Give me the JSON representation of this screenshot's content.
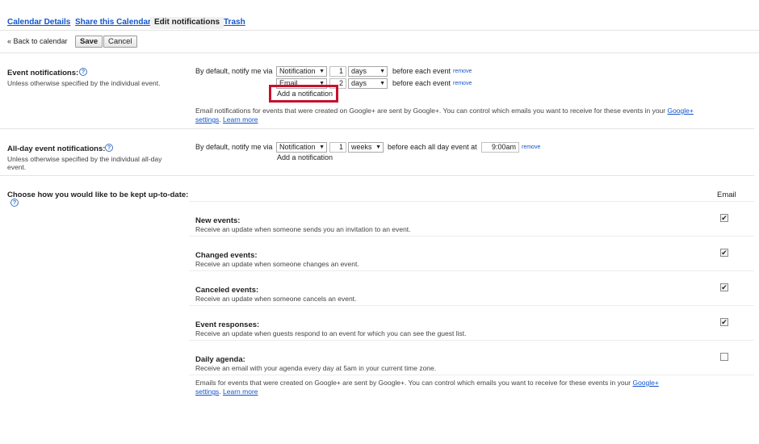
{
  "tabs": [
    {
      "label": "Calendar Details"
    },
    {
      "label": "Share this Calendar"
    },
    {
      "label": "Edit notifications"
    },
    {
      "label": "Trash"
    }
  ],
  "toolbar": {
    "back_label": "« Back to calendar",
    "save_label": "Save",
    "cancel_label": "Cancel"
  },
  "event_notifications": {
    "title": "Event notifications:",
    "subtitle": "Unless otherwise specified by the individual event.",
    "default_label": "By default, notify me via",
    "rows": [
      {
        "method": "Notification",
        "amount": "1",
        "unit": "days",
        "suffix": "before each event",
        "remove": "remove"
      },
      {
        "method": "Email",
        "amount": "2",
        "unit": "days",
        "suffix": "before each event",
        "remove": "remove"
      }
    ],
    "add_label": "Add a notification",
    "note_prefix": "Email notifications for events that were created on Google+ are sent by Google+. You can control which emails you want to receive for these events in your ",
    "note_link1_a": "Google+",
    "note_link1_b": "settings",
    "note_link2": "Learn more"
  },
  "allday_notifications": {
    "title": "All-day event notifications:",
    "subtitle_l1": "Unless otherwise specified by the individual all-day",
    "subtitle_l2": "event.",
    "default_label": "By default, notify me via",
    "method": "Notification",
    "amount": "1",
    "unit": "weeks",
    "suffix": "before each all day event at",
    "time": "9:00am",
    "remove": "remove",
    "add_label": "Add a notification"
  },
  "updates": {
    "title": "Choose how you would like to be kept up-to-date:",
    "column_header": "Email",
    "items": [
      {
        "title": "New events:",
        "desc": "Receive an update when someone sends you an invitation to an event.",
        "checked": "✔"
      },
      {
        "title": "Changed events:",
        "desc": "Receive an update when someone changes an event.",
        "checked": "✔"
      },
      {
        "title": "Canceled events:",
        "desc": "Receive an update when someone cancels an event.",
        "checked": "✔"
      },
      {
        "title": "Event responses:",
        "desc": "Receive an update when guests respond to an event for which you can see the guest list.",
        "checked": "✔"
      },
      {
        "title": "Daily agenda:",
        "desc": "Receive an email with your agenda every day at 5am in your current time zone.",
        "checked": ""
      }
    ],
    "note_prefix": "Emails for events that were created on Google+ are sent by Google+. You can control which emails you want to receive for these events in your ",
    "note_link1_a": "Google+",
    "note_link1_b": "settings",
    "note_link2": "Learn more"
  },
  "icons": {
    "help": "?",
    "dropdown": "▼"
  },
  "colors": {
    "link": "#1155cc",
    "highlight_box": "#c8102e"
  }
}
